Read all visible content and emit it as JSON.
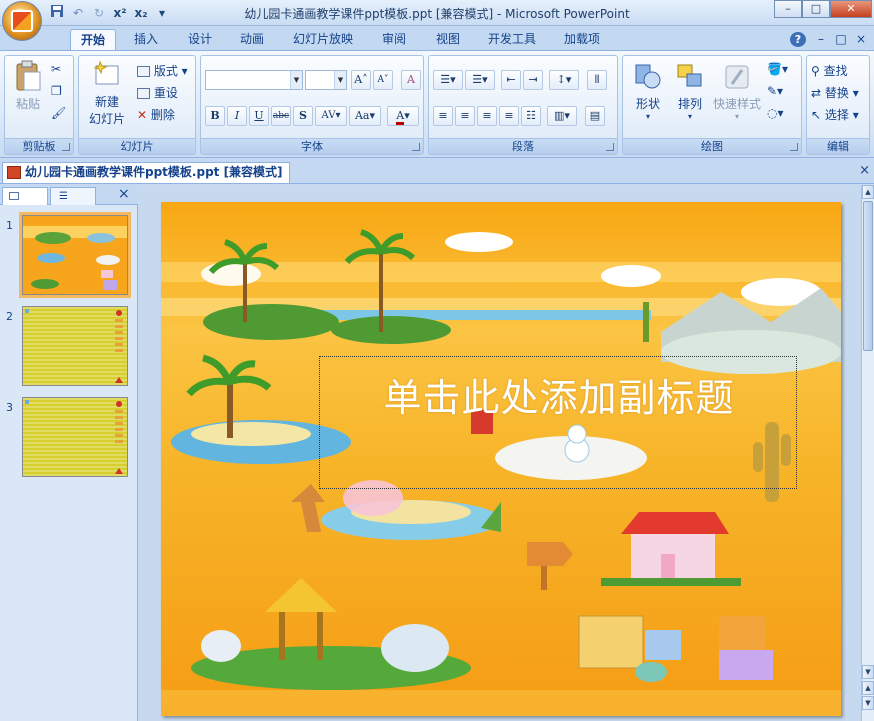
{
  "window": {
    "title": "幼儿园卡通画教学课件ppt模板.ppt [兼容模式] - Microsoft PowerPoint",
    "minimize": "–",
    "restore": "□",
    "close": "✕"
  },
  "quick_access": {
    "save_icon": "save-icon",
    "undo_icon": "undo-icon",
    "redo_icon": "redo-icon",
    "superscript": "x²",
    "subscript": "x₂",
    "customize": "▾"
  },
  "ribbon": {
    "tabs": [
      "开始",
      "插入",
      "设计",
      "动画",
      "幻灯片放映",
      "审阅",
      "视图",
      "开发工具",
      "加载项"
    ],
    "help": "?",
    "clipboard": {
      "label": "剪贴板",
      "paste": "粘贴"
    },
    "slides": {
      "label": "幻灯片",
      "new_slide_1": "新建",
      "new_slide_2": "幻灯片",
      "layout": "版式",
      "reset": "重设",
      "delete": "删除"
    },
    "font": {
      "label": "字体",
      "grow": "A",
      "shrink": "A",
      "clear": "A",
      "bold": "B",
      "italic": "I",
      "underline": "U",
      "strike": "abc",
      "shadow": "S",
      "spacing": "AV",
      "case": "Aa",
      "color": "A"
    },
    "paragraph": {
      "label": "段落"
    },
    "drawing": {
      "label": "绘图",
      "shapes": "形状",
      "arrange": "排列",
      "quick_styles": "快速样式"
    },
    "editing": {
      "label": "编辑",
      "find": "查找",
      "replace": "替换",
      "select": "选择"
    }
  },
  "document_tab": {
    "label": "幼儿园卡通画教学课件ppt模板.ppt [兼容模式]",
    "close": "×"
  },
  "slide_panel": {
    "close": "×",
    "thumbnails": [
      {
        "number": "1",
        "selected": true
      },
      {
        "number": "2",
        "selected": false
      },
      {
        "number": "3",
        "selected": false
      }
    ]
  },
  "slide": {
    "subtitle_placeholder": "单击此处添加副标题"
  },
  "colors": {
    "ribbon_blue": "#c3d9f2",
    "slide_orange": "#f7a51c",
    "slide_yellow": "#f6d94a",
    "thumb_yellow": "#d6cf2e"
  }
}
